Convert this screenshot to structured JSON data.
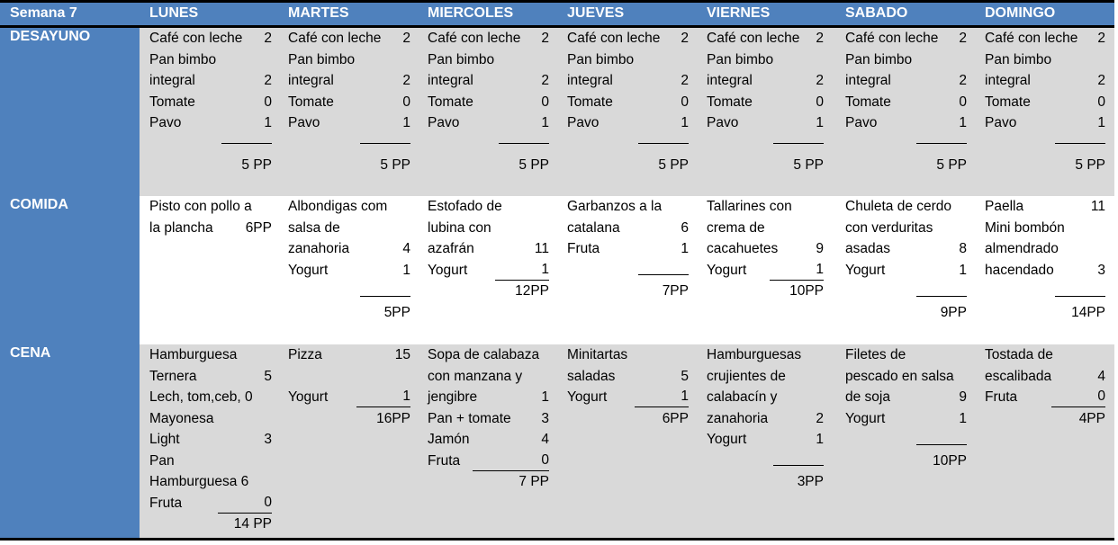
{
  "header": {
    "week": "Semana 7",
    "days": [
      "LUNES",
      "MARTES",
      "MIERCOLES",
      "JUEVES",
      "VIERNES",
      "SABADO",
      "DOMINGO"
    ]
  },
  "meals": [
    {
      "label": "DESAYUNO",
      "cells": [
        {
          "lines": [
            [
              "Café con leche",
              "2"
            ],
            [
              "Pan bimbo",
              ""
            ],
            [
              "integral",
              "2"
            ],
            [
              "Tomate",
              "0"
            ],
            [
              "Pavo",
              "1"
            ]
          ],
          "total": "5 PP"
        },
        {
          "lines": [
            [
              "Café con leche",
              "2"
            ],
            [
              "Pan bimbo",
              ""
            ],
            [
              "integral",
              "2"
            ],
            [
              "Tomate",
              "0"
            ],
            [
              "Pavo",
              "1"
            ]
          ],
          "total": "5 PP"
        },
        {
          "lines": [
            [
              "Café con leche",
              "2"
            ],
            [
              "Pan bimbo",
              ""
            ],
            [
              "integral",
              "2"
            ],
            [
              "Tomate",
              "0"
            ],
            [
              "Pavo",
              "1"
            ]
          ],
          "total": "5 PP"
        },
        {
          "lines": [
            [
              "Café con leche",
              "2"
            ],
            [
              "Pan bimbo",
              ""
            ],
            [
              "integral",
              "2"
            ],
            [
              "Tomate",
              "0"
            ],
            [
              "Pavo",
              "1"
            ]
          ],
          "total": "5 PP"
        },
        {
          "lines": [
            [
              "Café con leche",
              "2"
            ],
            [
              "Pan bimbo",
              ""
            ],
            [
              "integral",
              "2"
            ],
            [
              "Tomate",
              "0"
            ],
            [
              "Pavo",
              "1"
            ]
          ],
          "total": "5 PP"
        },
        {
          "lines": [
            [
              "Café con leche",
              "2"
            ],
            [
              "Pan bimbo",
              ""
            ],
            [
              "integral",
              "2"
            ],
            [
              "Tomate",
              "0"
            ],
            [
              "Pavo",
              "1"
            ]
          ],
          "total": "5 PP"
        },
        {
          "lines": [
            [
              "Café con leche",
              "2"
            ],
            [
              "Pan bimbo",
              ""
            ],
            [
              "integral",
              "2"
            ],
            [
              "Tomate",
              "0"
            ],
            [
              "Pavo",
              "1"
            ]
          ],
          "total": "5 PP"
        }
      ]
    },
    {
      "label": "COMIDA",
      "cells": [
        {
          "lines": [
            [
              "Pisto con pollo a",
              ""
            ],
            [
              "la plancha",
              "6PP"
            ]
          ],
          "total": ""
        },
        {
          "lines": [
            [
              "Albondigas com",
              ""
            ],
            [
              "salsa de",
              ""
            ],
            [
              "zanahoria",
              "4"
            ],
            [
              "Yogurt",
              "1"
            ]
          ],
          "total": "5PP"
        },
        {
          "lines": [
            [
              "Estofado de",
              ""
            ],
            [
              "lubina con",
              ""
            ],
            [
              "azafrán",
              "11"
            ],
            [
              "Yogurt",
              "1"
            ]
          ],
          "total": "12PP"
        },
        {
          "lines": [
            [
              "Garbanzos a la",
              ""
            ],
            [
              "catalana",
              "6"
            ],
            [
              "Fruta",
              "1"
            ]
          ],
          "total": "7PP"
        },
        {
          "lines": [
            [
              "Tallarines con",
              ""
            ],
            [
              "crema de",
              ""
            ],
            [
              "cacahuetes",
              "9"
            ],
            [
              "Yogurt",
              "1"
            ]
          ],
          "total": "10PP"
        },
        {
          "lines": [
            [
              "Chuleta de cerdo",
              ""
            ],
            [
              "con verduritas",
              ""
            ],
            [
              "asadas",
              "8"
            ],
            [
              "Yogurt",
              "1"
            ]
          ],
          "total": "9PP"
        },
        {
          "lines": [
            [
              "Paella",
              "11"
            ],
            [
              "Mini bombón",
              ""
            ],
            [
              "almendrado",
              ""
            ],
            [
              "hacendado",
              "3"
            ]
          ],
          "total": "14PP"
        }
      ]
    },
    {
      "label": "CENA",
      "cells": [
        {
          "lines": [
            [
              "Hamburguesa",
              ""
            ],
            [
              "Ternera",
              "5"
            ],
            [
              "Lech, tom,ceb, 0",
              ""
            ],
            [
              "Mayonesa",
              ""
            ],
            [
              "Light",
              "3"
            ],
            [
              "Pan",
              ""
            ],
            [
              "Hamburguesa 6",
              ""
            ],
            [
              "Fruta",
              "0"
            ]
          ],
          "total": "14 PP"
        },
        {
          "lines": [
            [
              "Pizza",
              "15"
            ],
            [
              "",
              ""
            ],
            [
              "Yogurt",
              "1"
            ]
          ],
          "total": "16PP"
        },
        {
          "lines": [
            [
              "Sopa de calabaza",
              ""
            ],
            [
              "con manzana y",
              ""
            ],
            [
              "jengibre",
              "1"
            ],
            [
              "Pan + tomate",
              "3"
            ],
            [
              "Jamón",
              "4"
            ],
            [
              "Fruta",
              "0"
            ]
          ],
          "total": "7 PP"
        },
        {
          "lines": [
            [
              "Minitartas",
              ""
            ],
            [
              "saladas",
              "5"
            ],
            [
              "Yogurt",
              "1"
            ]
          ],
          "total": "6PP"
        },
        {
          "lines": [
            [
              "Hamburguesas",
              ""
            ],
            [
              "crujientes de",
              ""
            ],
            [
              "calabacín y",
              ""
            ],
            [
              "zanahoria",
              "2"
            ],
            [
              "Yogurt",
              "1"
            ]
          ],
          "total": "3PP"
        },
        {
          "lines": [
            [
              "Filetes de",
              ""
            ],
            [
              "pescado en salsa",
              ""
            ],
            [
              "de soja",
              "9"
            ],
            [
              "Yogurt",
              "1"
            ]
          ],
          "total": "10PP"
        },
        {
          "lines": [
            [
              "Tostada de",
              ""
            ],
            [
              "escalibada",
              "4"
            ],
            [
              "Fruta",
              "0"
            ]
          ],
          "total": "4PP"
        }
      ]
    }
  ]
}
